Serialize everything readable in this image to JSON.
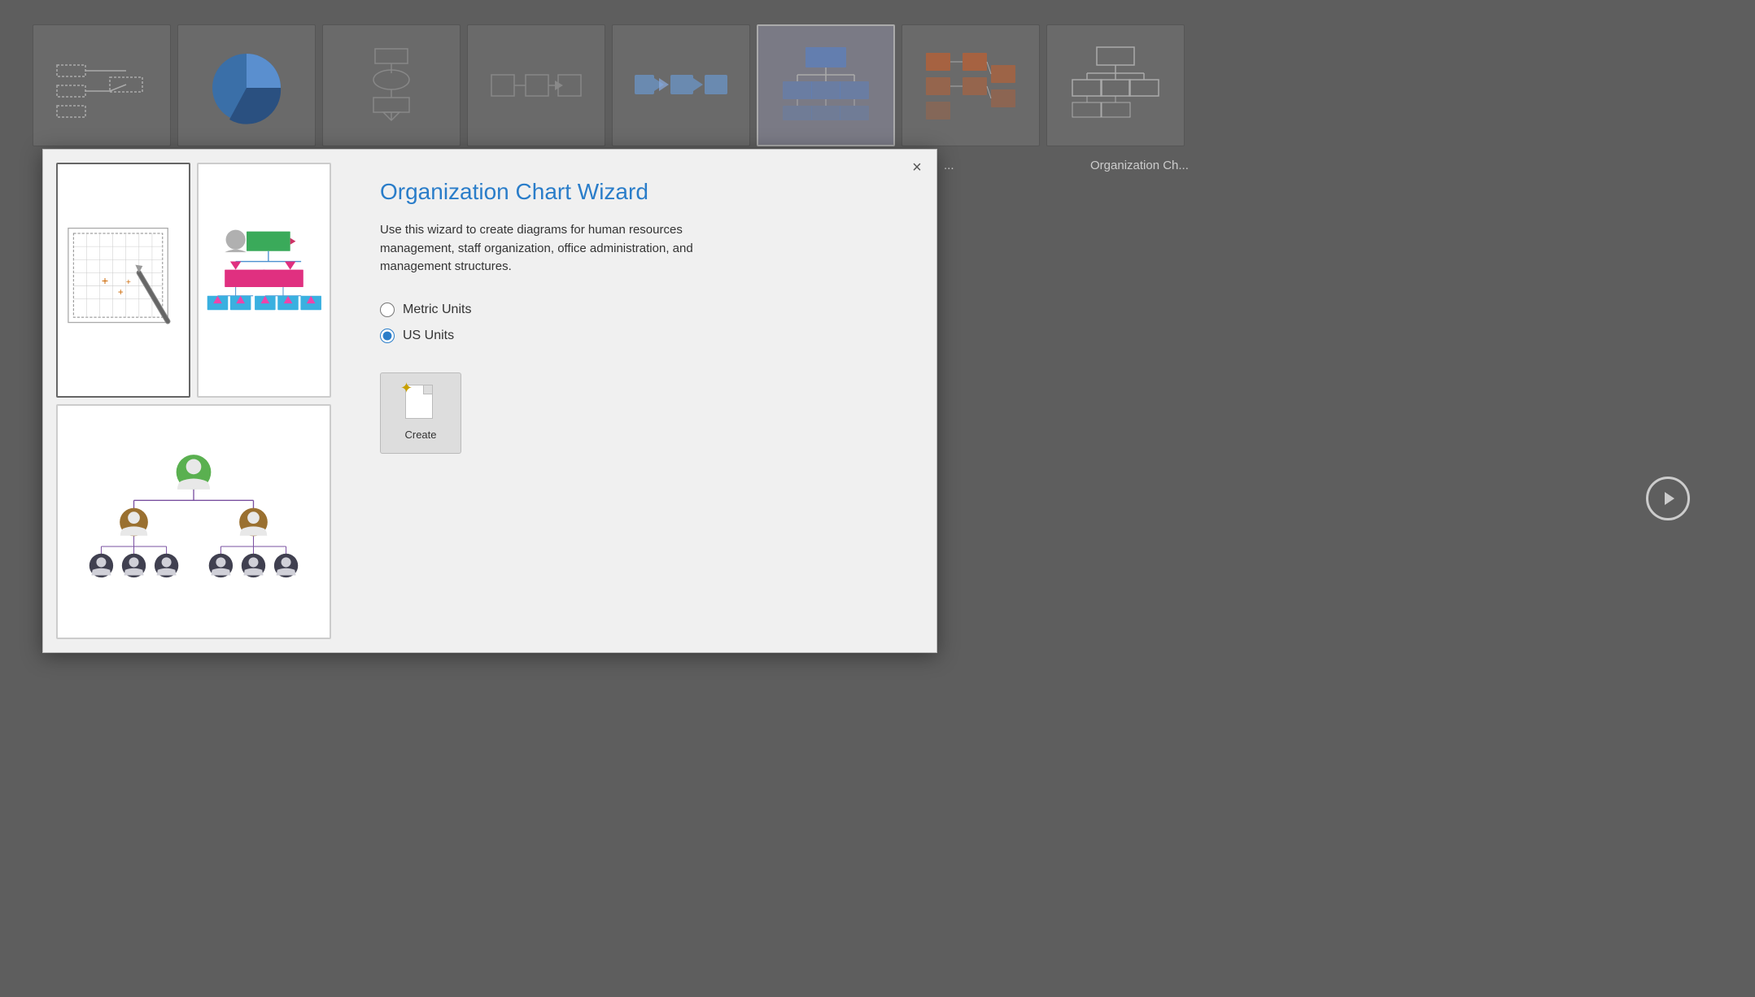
{
  "background": {
    "thumbnails": [
      {
        "id": "thumb-network",
        "label": "Network diagram"
      },
      {
        "id": "thumb-pie",
        "label": "Pie chart"
      },
      {
        "id": "thumb-flowchart",
        "label": "Flowchart"
      },
      {
        "id": "thumb-process",
        "label": "Process diagram"
      },
      {
        "id": "thumb-data-flow",
        "label": "Data flow"
      },
      {
        "id": "thumb-sitemap",
        "label": "Site map / org",
        "selected": true
      },
      {
        "id": "thumb-itinfra",
        "label": "IT Infrastructure"
      },
      {
        "id": "thumb-orgchart2",
        "label": "Organization Chart"
      }
    ],
    "label1": "...",
    "label2": "Organization Ch..."
  },
  "dialog": {
    "title": "Organization Chart Wizard",
    "description": "Use this wizard to create diagrams for human resources management, staff organization, office administration, and management structures.",
    "close_label": "×",
    "radio_group": {
      "options": [
        {
          "id": "metric",
          "label": "Metric Units",
          "checked": false
        },
        {
          "id": "us",
          "label": "US Units",
          "checked": true
        }
      ]
    },
    "create_button_label": "Create",
    "thumbnails": [
      {
        "id": "grid-thumb",
        "label": "Grid with pencil",
        "active": true
      },
      {
        "id": "colorful-org-thumb",
        "label": "Colorful org chart"
      },
      {
        "id": "person-org-thumb",
        "label": "Person org chart"
      }
    ]
  }
}
